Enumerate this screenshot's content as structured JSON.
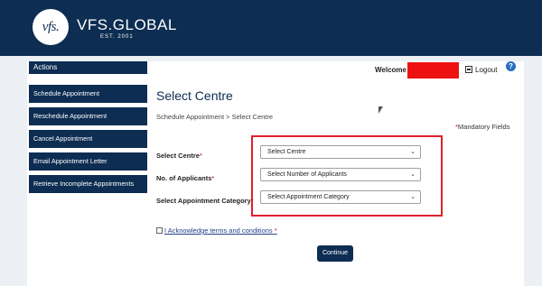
{
  "brand": {
    "logo_text": "vfs.",
    "name": "VFS.GLOBAL",
    "sub": "EST. 2001",
    "color": "#0d2d52"
  },
  "sidebar": {
    "header": "Actions",
    "items": [
      {
        "label": "Schedule Appointment"
      },
      {
        "label": "Reschedule Appointment"
      },
      {
        "label": "Cancel Appointment"
      },
      {
        "label": "Email Appointment Letter"
      },
      {
        "label": "Retrieve Incomplete Appointments"
      }
    ]
  },
  "topbar": {
    "welcome": "Welcome",
    "logout": "Logout",
    "help": "?"
  },
  "page": {
    "title": "Select Centre",
    "breadcrumb": "Schedule Appointment  >  Select Centre",
    "mandatory": "Mandatory Fields",
    "asterisk": "*"
  },
  "form": {
    "fields": [
      {
        "label": "Select Centre",
        "value": "Select Centre"
      },
      {
        "label": "No. of Applicants",
        "value": "Select Number of Applicants"
      },
      {
        "label": "Select Appointment Category",
        "value": "Select Appointment Category"
      }
    ],
    "acknowledge": "I Acknowledge terms and conditions",
    "continue": "Continue"
  },
  "icons": {
    "chevron": "⌄",
    "highlight_color": "#e0212b"
  }
}
